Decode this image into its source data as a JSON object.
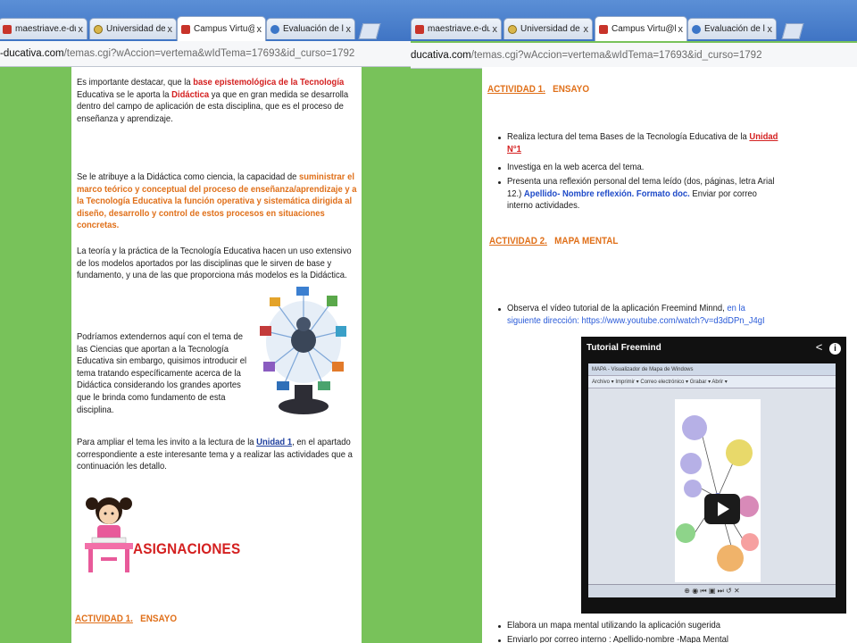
{
  "left_window": {
    "tabs": [
      {
        "label": "maestriave.e-ducativa.co",
        "active": false
      },
      {
        "label": "Universidad de Panamá -",
        "active": false
      },
      {
        "label": "Campus Virtu@l [Módulo",
        "active": true
      },
      {
        "label": "Evaluación de los aprendi",
        "active": false
      }
    ],
    "tab_close_glyph": "x",
    "url_host": "-ducativa.com",
    "url_path": "/temas.cgi?wAccion=vertema&wIdTema=17693&id_curso=1792",
    "para1": {
      "p1": "Es importante destacar, que la ",
      "p1_hl": "base epistemológica de la Tecnología",
      "p2": " Educativa se le aporta la ",
      "p2_hl": "Didáctica",
      "p3": " ya que en gran medida se desarrolla dentro del campo de aplicación de esta disciplina, que es el proceso de enseñanza y aprendizaje."
    },
    "para2": {
      "p1": "Se le atribuye a la Didáctica como ciencia, la capacidad de ",
      "p1_hl": "suministrar el marco teórico y conceptual del proceso de enseñanza/aprendizaje y a la Tecnología Educativa la función operativa y sistemática dirigida al diseño, desarrollo y control de estos procesos en situaciones concretas."
    },
    "para3": "La teoría y la práctica de la Tecnología Educativa hacen un uso extensivo de los modelos aportados por las disciplinas que le sirven de base y fundamento, y una de las que proporciona más modelos es la Didáctica.",
    "para4": "Podríamos extendernos aquí con el tema de las Ciencias que aportan a la Tecnología Educativa sin embargo, quisimos introducir el tema tratando específicamente acerca de la Didáctica considerando los grandes aportes que le brinda como fundamento de esta disciplina.",
    "para5": {
      "p1": "Para ampliar el tema les invito a la lectura de la ",
      "link": "Unidad 1",
      "p2": ", en el apartado correspondiente a este interesante tema y a realizar las actividades que a continuación les detallo."
    },
    "asignaciones": "ASIGNACIONES",
    "actividad1": {
      "label": "ACTIVIDAD 1.",
      "title": "ENSAYO"
    }
  },
  "right_window": {
    "tabs": [
      {
        "label": "maestriave.e-ducativa.co",
        "active": false
      },
      {
        "label": "Universidad de Panamá -",
        "active": false
      },
      {
        "label": "Campus Virtu@l [Módulo",
        "active": true
      },
      {
        "label": "Evaluación de los aprendi",
        "active": false
      }
    ],
    "tab_close_glyph": "x",
    "url_host": "ducativa.com",
    "url_path": "/temas.cgi?wAccion=vertema&wIdTema=17693&id_curso=1792",
    "actividad1": {
      "label": "ACTIVIDAD 1.",
      "title": "ENSAYO",
      "b1_text": "Realiza lectura del tema Bases de la Tecnología Educativa de la ",
      "b1_link": "Unidad N°1",
      "b2": "Investiga en la web acerca del tema.",
      "b3_text": "Presenta una reflexión personal del tema leído (dos, páginas, letra Arial 12.) ",
      "b3_hl": "Apellido- Nombre reflexión. Formato doc.",
      "b3_tail": " Enviar por correo interno actividades."
    },
    "actividad2": {
      "label": "ACTIVIDAD 2.",
      "title": "MAPA MENTAL",
      "b1_text": "Observa el vídeo tutorial de la aplicación Freemind Minnd, ",
      "b1_blue": "en la siguiente dirección: https://www.youtube.com/watch?v=d3dDPn_J4gI",
      "b2": "Elabora un mapa mental utilizando la aplicación sugerida",
      "b3": "Enviarlo por correo interno : Apellido-nombre -Mapa Mental"
    },
    "video": {
      "title": "Tutorial Freemind",
      "share_icon": "share-icon",
      "info_icon": "info-icon",
      "app_title": "MAPA  - Visualizador de Mapa de Windows",
      "menu": "Archivo ▾   Imprimir ▾   Correo electrónico ▾   Grabar ▾   Abrir ▾",
      "controls": "⊕ ◉ ⏮ ▣ ⏭ ↺ ✕"
    }
  },
  "colors": {
    "background_green": "#78c25a",
    "highlight_red": "#d42020",
    "highlight_orange": "#e0701a",
    "link_blue": "#1e3f9e"
  }
}
